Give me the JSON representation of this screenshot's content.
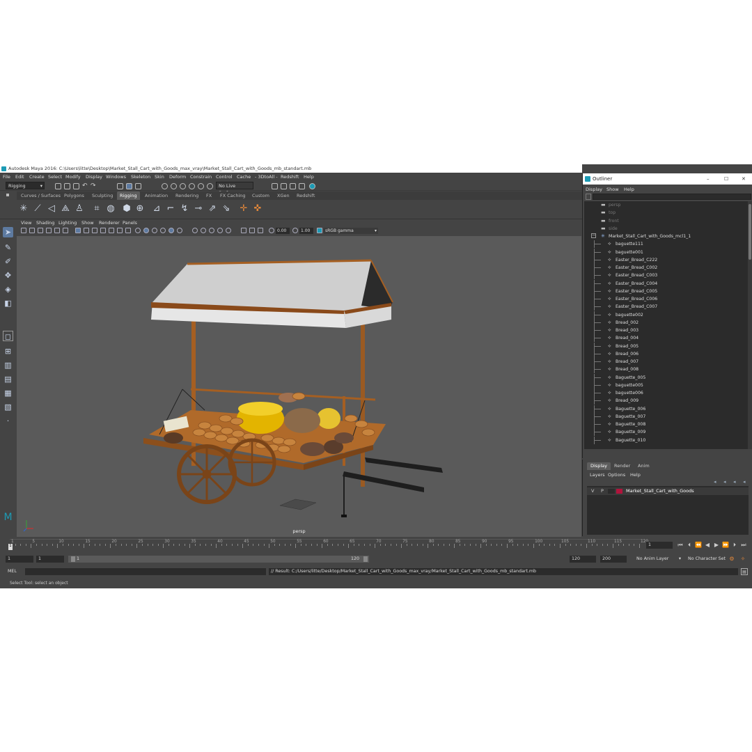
{
  "title_bar": {
    "text": "Autodesk Maya 2016: C:\\Users\\litte\\Desktop\\Market_Stall_Cart_with_Goods_max_vray\\Market_Stall_Cart_with_Goods_mb_standart.mb"
  },
  "menus": [
    "File",
    "Edit",
    "Create",
    "Select",
    "Modify",
    "Display",
    "Windows",
    "Skeleton",
    "Skin",
    "Deform",
    "Constrain",
    "Control",
    "Cache",
    "- 3DtoAll -",
    "Redshift",
    "Help"
  ],
  "status_line": {
    "mode": "Rigging",
    "live_surface": "No Live Surface"
  },
  "shelf_tabs": [
    "Curves / Surfaces",
    "Polygons",
    "Sculpting",
    "Rigging",
    "Animation",
    "Rendering",
    "FX",
    "FX Caching",
    "Custom",
    "XGen",
    "Redshift"
  ],
  "active_shelf_tab": "Rigging",
  "viewport_menu": [
    "View",
    "Shading",
    "Lighting",
    "Show",
    "Renderer",
    "Panels"
  ],
  "viewport_tools": {
    "exposure": "0.00",
    "gamma": "1.00",
    "color_space": "sRGB gamma"
  },
  "viewport": {
    "camera_label": "persp"
  },
  "outliner": {
    "title": "Outliner",
    "menu": [
      "Display",
      "Show",
      "Help"
    ],
    "cameras": [
      "persp",
      "top",
      "front",
      "side"
    ],
    "root": "Market_Stall_Cart_with_Goods_mcl1_1",
    "items": [
      "baguette111",
      "baguette001",
      "Easter_Bread_C222",
      "Easter_Bread_C002",
      "Easter_Bread_C003",
      "Easter_Bread_C004",
      "Easter_Bread_C005",
      "Easter_Bread_C006",
      "Easter_Bread_C007",
      "baguette002",
      "Bread_002",
      "Bread_003",
      "Bread_004",
      "Bread_005",
      "Bread_006",
      "Bread_007",
      "Bread_008",
      "Baguette_005",
      "baguette005",
      "baguette006",
      "Bread_009",
      "Baguette_006",
      "Baguette_007",
      "Baguette_008",
      "Baguette_009",
      "Baguette_010"
    ]
  },
  "layer_editor": {
    "tabs": [
      "Display",
      "Render",
      "Anim"
    ],
    "menu": [
      "Layers",
      "Options",
      "Help"
    ],
    "layer": {
      "v": "V",
      "p": "P",
      "name": "Market_Stall_Cart_with_Goods",
      "color": "#b0143c"
    }
  },
  "time_slider": {
    "ticks": [
      "1",
      "5",
      "10",
      "15",
      "20",
      "25",
      "30",
      "35",
      "40",
      "45",
      "50",
      "55",
      "60",
      "65",
      "70",
      "75",
      "80",
      "85",
      "90",
      "95",
      "100",
      "105",
      "110",
      "115",
      "120"
    ],
    "current_frame": "1",
    "current_marker": "1"
  },
  "range_slider": {
    "start": "1",
    "playback_start": "1",
    "range_start_label": "1",
    "range_end_label": "120",
    "playback_end": "120",
    "end": "200",
    "anim_layer": "No Anim Layer",
    "character_set": "No Character Set"
  },
  "command_line": {
    "lang": "MEL",
    "result": "// Result: C:/Users/litte/Desktop/Market_Stall_Cart_with_Goods_max_vray/Market_Stall_Cart_with_Goods_mb_standart.mb"
  },
  "help_line": {
    "text": "Select Tool: select an object"
  },
  "colors": {
    "ui_bg": "#444444",
    "viewport_bg": "#5a5a5a",
    "field_bg": "#2b2b2b",
    "maya_blue": "#1d9bb5",
    "wood": "#b06a2a",
    "canvas": "#d8d8d8"
  }
}
